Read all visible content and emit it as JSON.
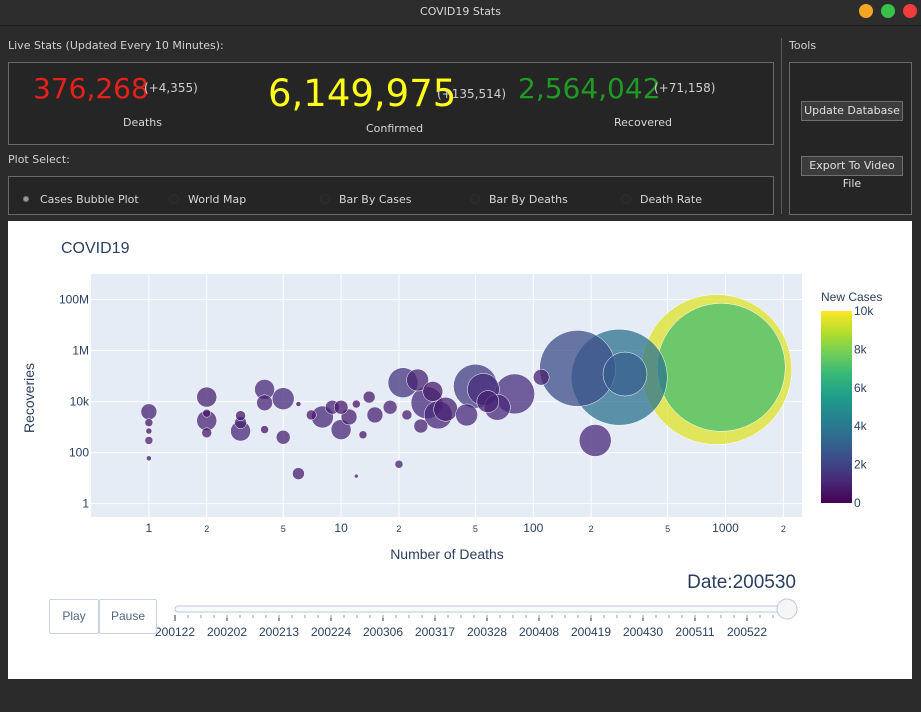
{
  "window": {
    "title": "COVID19 Stats"
  },
  "stats_label": "Live Stats (Updated Every 10 Minutes):",
  "stats": {
    "deaths": {
      "value": "376,268",
      "delta": "(+4,355)",
      "caption": "Deaths",
      "color": "#e8201c"
    },
    "confirmed": {
      "value": "6,149,975",
      "delta": "(+135,514)",
      "caption": "Confirmed",
      "color": "#ffff1a"
    },
    "recovered": {
      "value": "2,564,042",
      "delta": "(+71,158)",
      "caption": "Recovered",
      "color": "#1f9a24"
    }
  },
  "plot_select": {
    "label": "Plot Select:",
    "options": [
      "Cases Bubble Plot",
      "World Map",
      "Bar By Cases",
      "Bar By Deaths",
      "Death Rate"
    ],
    "selected": "Cases Bubble Plot"
  },
  "tools": {
    "label": "Tools",
    "update_label": "Update Database",
    "export_label": "Export To Video File"
  },
  "player": {
    "play_label": "Play",
    "pause_label": "Pause",
    "current_label": "Date:200530",
    "steps": [
      "200122",
      "200202",
      "200213",
      "200224",
      "200306",
      "200317",
      "200328",
      "200408",
      "200419",
      "200430",
      "200511",
      "200522"
    ],
    "progress": 1.0
  },
  "chart_data": {
    "type": "scatter",
    "title": "COVID19",
    "xlabel": "Number of Deaths",
    "ylabel": "Recoveries",
    "x_scale": "log",
    "y_scale": "log",
    "xlim": [
      0.5,
      2500
    ],
    "ylim": [
      0.3,
      1000000000
    ],
    "x_ticks": [
      {
        "v": 1,
        "t": "1",
        "major": true
      },
      {
        "v": 2,
        "t": "2"
      },
      {
        "v": 5,
        "t": "5"
      },
      {
        "v": 10,
        "t": "10",
        "major": true
      },
      {
        "v": 20,
        "t": "2"
      },
      {
        "v": 50,
        "t": "5"
      },
      {
        "v": 100,
        "t": "100",
        "major": true
      },
      {
        "v": 200,
        "t": "2"
      },
      {
        "v": 500,
        "t": "5"
      },
      {
        "v": 1000,
        "t": "1000",
        "major": true
      },
      {
        "v": 2000,
        "t": "2"
      }
    ],
    "y_ticks": [
      {
        "v": 1,
        "t": "1"
      },
      {
        "v": 100,
        "t": "100"
      },
      {
        "v": 10000,
        "t": "10k"
      },
      {
        "v": 1000000,
        "t": "1M"
      },
      {
        "v": 100000000,
        "t": "100M"
      }
    ],
    "colorbar": {
      "title": "New Cases",
      "ticks": [
        {
          "v": 0,
          "t": "0"
        },
        {
          "v": 2000,
          "t": "2k"
        },
        {
          "v": 4000,
          "t": "4k"
        },
        {
          "v": 6000,
          "t": "6k"
        },
        {
          "v": 8000,
          "t": "8k"
        },
        {
          "v": 10000,
          "t": "10k"
        }
      ],
      "range": [
        0,
        10000
      ]
    },
    "grid": true,
    "points": [
      {
        "x": 1,
        "y": 4000,
        "c": 900,
        "r": 8
      },
      {
        "x": 1,
        "y": 1500,
        "c": 600,
        "r": 4
      },
      {
        "x": 1,
        "y": 700,
        "c": 500,
        "r": 3
      },
      {
        "x": 1,
        "y": 300,
        "c": 800,
        "r": 4
      },
      {
        "x": 1,
        "y": 60,
        "c": 600,
        "r": 2.5
      },
      {
        "x": 2,
        "y": 15000,
        "c": 900,
        "r": 10
      },
      {
        "x": 2,
        "y": 1800,
        "c": 1000,
        "r": 10
      },
      {
        "x": 2,
        "y": 600,
        "c": 700,
        "r": 5
      },
      {
        "x": 2,
        "y": 3500,
        "c": 500,
        "r": 4
      },
      {
        "x": 3,
        "y": 700,
        "c": 1100,
        "r": 10
      },
      {
        "x": 3,
        "y": 1500,
        "c": 900,
        "r": 6
      },
      {
        "x": 3,
        "y": 2800,
        "c": 700,
        "r": 5
      },
      {
        "x": 4,
        "y": 9000,
        "c": 1000,
        "r": 8
      },
      {
        "x": 4,
        "y": 30000,
        "c": 1100,
        "r": 10
      },
      {
        "x": 4,
        "y": 800,
        "c": 500,
        "r": 4
      },
      {
        "x": 5,
        "y": 13000,
        "c": 1200,
        "r": 11
      },
      {
        "x": 5,
        "y": 400,
        "c": 900,
        "r": 7
      },
      {
        "x": 6,
        "y": 8000,
        "c": 400,
        "r": 2.5
      },
      {
        "x": 6,
        "y": 15,
        "c": 800,
        "r": 6
      },
      {
        "x": 7,
        "y": 3000,
        "c": 700,
        "r": 5
      },
      {
        "x": 8,
        "y": 2500,
        "c": 1100,
        "r": 11
      },
      {
        "x": 9,
        "y": 6000,
        "c": 900,
        "r": 7
      },
      {
        "x": 10,
        "y": 800,
        "c": 1100,
        "r": 10
      },
      {
        "x": 10,
        "y": 6000,
        "c": 700,
        "r": 7
      },
      {
        "x": 11,
        "y": 2500,
        "c": 900,
        "r": 8
      },
      {
        "x": 12,
        "y": 8000,
        "c": 500,
        "r": 4
      },
      {
        "x": 12,
        "y": 12,
        "c": 600,
        "r": 2
      },
      {
        "x": 13,
        "y": 500,
        "c": 600,
        "r": 4
      },
      {
        "x": 14,
        "y": 15000,
        "c": 700,
        "r": 6
      },
      {
        "x": 15,
        "y": 3000,
        "c": 900,
        "r": 8
      },
      {
        "x": 18,
        "y": 6000,
        "c": 1000,
        "r": 7
      },
      {
        "x": 20,
        "y": 35,
        "c": 800,
        "r": 4
      },
      {
        "x": 21,
        "y": 55000,
        "c": 1500,
        "r": 15
      },
      {
        "x": 22,
        "y": 3000,
        "c": 800,
        "r": 5
      },
      {
        "x": 25,
        "y": 70000,
        "c": 900,
        "r": 11
      },
      {
        "x": 26,
        "y": 1100,
        "c": 900,
        "r": 7
      },
      {
        "x": 28,
        "y": 9000,
        "c": 1200,
        "r": 16
      },
      {
        "x": 30,
        "y": 25000,
        "c": 800,
        "r": 10
      },
      {
        "x": 32,
        "y": 3000,
        "c": 1100,
        "r": 14
      },
      {
        "x": 35,
        "y": 5000,
        "c": 900,
        "r": 12
      },
      {
        "x": 45,
        "y": 3000,
        "c": 1100,
        "r": 11
      },
      {
        "x": 50,
        "y": 40000,
        "c": 1800,
        "r": 22
      },
      {
        "x": 55,
        "y": 30000,
        "c": 1300,
        "r": 16
      },
      {
        "x": 58,
        "y": 10000,
        "c": 900,
        "r": 11
      },
      {
        "x": 65,
        "y": 6000,
        "c": 1100,
        "r": 13
      },
      {
        "x": 80,
        "y": 20000,
        "c": 1300,
        "r": 20
      },
      {
        "x": 110,
        "y": 90000,
        "c": 900,
        "r": 8
      },
      {
        "x": 170,
        "y": 200000,
        "c": 2400,
        "r": 38
      },
      {
        "x": 210,
        "y": 300,
        "c": 1100,
        "r": 16
      },
      {
        "x": 280,
        "y": 90000,
        "c": 3800,
        "r": 48
      },
      {
        "x": 300,
        "y": 120000,
        "c": 3000,
        "r": 22
      },
      {
        "x": 900,
        "y": 180000,
        "c": 9500,
        "r": 75
      },
      {
        "x": 950,
        "y": 220000,
        "c": 7000,
        "r": 64
      }
    ]
  }
}
